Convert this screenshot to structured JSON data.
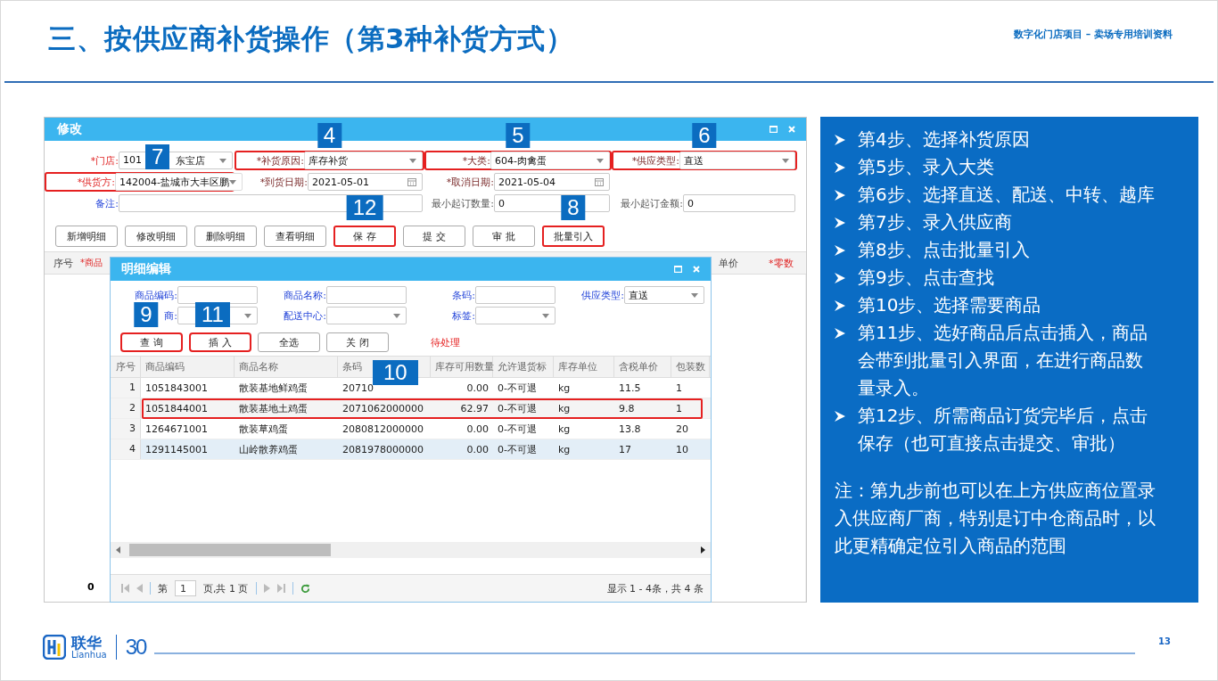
{
  "header": {
    "title": "三、按供应商补货操作（第3种补货方式）",
    "subtitle": "数字化门店项目 – 卖场专用培训资料"
  },
  "main_window": {
    "title": "修改",
    "fields": [
      {
        "label": "*门店:",
        "kind": "select",
        "value_parts": [
          "101",
          "东宝店"
        ],
        "highlighted": false
      },
      {
        "label": "*补货原因:",
        "kind": "select",
        "value_parts": [
          "库存补货"
        ],
        "highlighted": true,
        "callout": "4"
      },
      {
        "label": "*大类:",
        "kind": "select",
        "value_parts": [
          "604-肉禽蛋"
        ],
        "highlighted": true,
        "callout": "5"
      },
      {
        "label": "*供应类型:",
        "kind": "select",
        "value_parts": [
          "直送"
        ],
        "highlighted": true,
        "callout": "6"
      },
      {
        "label": "*供货方:",
        "kind": "select",
        "value_parts": [
          "142004-盐城市大丰区鹏"
        ],
        "highlighted": true,
        "callout": "7"
      },
      {
        "label": "*到货日期:",
        "kind": "date",
        "value_parts": [
          "2021-05-01"
        ],
        "highlighted": false
      },
      {
        "label": "*取消日期:",
        "kind": "date",
        "value_parts": [
          "2021-05-04"
        ],
        "highlighted": false
      },
      {
        "label": "备注:",
        "kind": "text",
        "highlighted": false
      },
      {
        "label": "最小起订数量:",
        "kind": "text",
        "value_parts": [
          "0"
        ],
        "highlighted": false
      },
      {
        "label": "最小起订金额:",
        "kind": "text",
        "value_parts": [
          "0"
        ],
        "highlighted": false
      }
    ],
    "buttons": [
      {
        "label": "新增明细",
        "highlighted": false
      },
      {
        "label": "修改明细",
        "highlighted": false
      },
      {
        "label": "删除明细",
        "highlighted": false
      },
      {
        "label": "查看明细",
        "highlighted": false
      },
      {
        "label": "保 存",
        "highlighted": true,
        "callout": "12"
      },
      {
        "label": "提 交",
        "highlighted": false
      },
      {
        "label": "审 批",
        "highlighted": false
      },
      {
        "label": "批量引入",
        "highlighted": true,
        "callout": "8"
      }
    ],
    "grid_columns": [
      {
        "label": "序号",
        "kind": "plain"
      },
      {
        "label": "*商品",
        "kind": "required"
      },
      {
        "label": "单价",
        "kind": "plain"
      },
      {
        "label": "*零数",
        "kind": "required"
      }
    ],
    "total": "0"
  },
  "detail_dialog": {
    "title": "明细编辑",
    "fields": [
      {
        "label": "商品编码:",
        "kind": "text"
      },
      {
        "label": "商品名称:",
        "kind": "text"
      },
      {
        "label": "条码:",
        "kind": "text"
      },
      {
        "label": "供应类型:",
        "kind": "select",
        "value": "直送"
      },
      {
        "label": "商:",
        "kind": "select"
      },
      {
        "label": "配送中心:",
        "kind": "select"
      },
      {
        "label": "标签:",
        "kind": "select"
      }
    ],
    "buttons": [
      {
        "label": "查 询",
        "highlighted": true,
        "callout": "9"
      },
      {
        "label": "插 入",
        "highlighted": true,
        "callout": "11"
      },
      {
        "label": "全选",
        "highlighted": false
      },
      {
        "label": "关 闭",
        "highlighted": false
      }
    ],
    "status": "待处理",
    "table": {
      "callout": "10",
      "columns": [
        "序号",
        "商品编码",
        "商品名称",
        "条码",
        "库存可用数量",
        "允许退货标",
        "库存单位",
        "含税单价",
        "包装数"
      ],
      "rows": [
        {
          "cells": [
            "1",
            "1051843001",
            "散装基地鲜鸡蛋",
            "20710",
            "0.00",
            "0-不可退",
            "kg",
            "11.5",
            "1"
          ],
          "selected": false,
          "highlighted": false
        },
        {
          "cells": [
            "2",
            "1051844001",
            "散装基地土鸡蛋",
            "2071062000000",
            "62.97",
            "0-不可退",
            "kg",
            "9.8",
            "1"
          ],
          "selected": false,
          "highlighted": true
        },
        {
          "cells": [
            "3",
            "1264671001",
            "散装草鸡蛋",
            "2080812000000",
            "0.00",
            "0-不可退",
            "kg",
            "13.8",
            "20"
          ],
          "selected": false,
          "highlighted": false
        },
        {
          "cells": [
            "4",
            "1291145001",
            "山岭散养鸡蛋",
            "2081978000000",
            "0.00",
            "0-不可退",
            "kg",
            "17",
            "10"
          ],
          "selected": true,
          "highlighted": false
        }
      ]
    },
    "pager": {
      "before": "第",
      "page": "1",
      "after": "页,共 1 页",
      "summary": "显示 1 - 4条，共 4 条"
    }
  },
  "steps": [
    "第4步、选择补货原因",
    "第5步、录入大类",
    "第6步、选择直送、配送、中转、越库",
    "第7步、录入供应商",
    "第8步、点击批量引入",
    "第9步、点击查找",
    "第10步、选择需要商品",
    "第11步、选好商品后点击插入，商品会带到批量引入界面，在进行商品数量录入。",
    "第12步、所需商品订货完毕后，点击保存（也可直接点击提交、审批）"
  ],
  "note": "注：第九步前也可以在上方供应商位置录入供应商厂商，特别是订中仓商品时，以此更精确定位引入商品的范围",
  "footer": {
    "brand_cn": "联华",
    "brand_en": "Lianhua",
    "anniversary": "30",
    "page_number": "13"
  }
}
